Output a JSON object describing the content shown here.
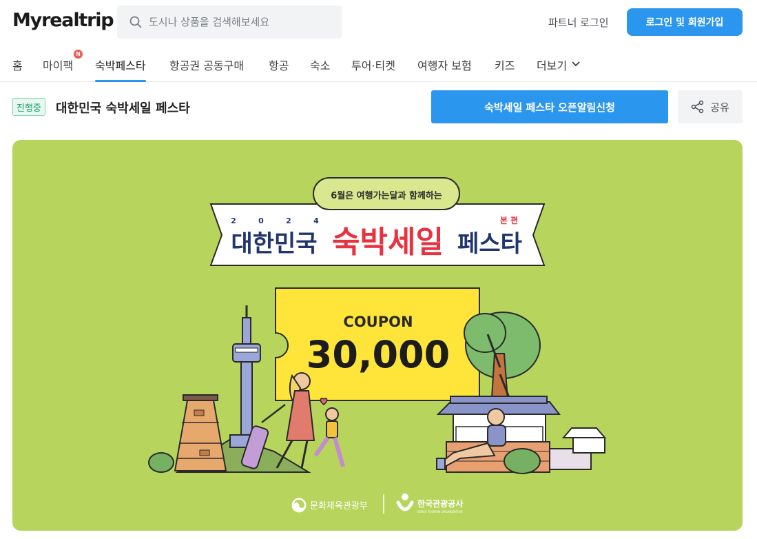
{
  "header": {
    "logo": "Myrealtrip",
    "search_placeholder": "도시나 상품을 검색해보세요",
    "partner_login": "파트너 로그인",
    "login_signup": "로그인 및 회원가입"
  },
  "nav": {
    "items": [
      "홈",
      "마이팩",
      "숙박페스타",
      "항공권 공동구매",
      "항공",
      "숙소",
      "투어·티켓",
      "여행자 보험",
      "키즈",
      "더보기"
    ],
    "badge": "N",
    "active": "숙박페스타"
  },
  "title_bar": {
    "status": "진행중",
    "title": "대한민국 숙박세일 페스타",
    "notify_button": "숙박세일 페스타 오픈알림신청",
    "share_button": "공유"
  },
  "banner": {
    "tagline": "6월은 여행가는달과 함께하는",
    "year_digits": [
      "2",
      "0",
      "2",
      "4"
    ],
    "headline_left": "대한민국",
    "headline_main": "숙박세일",
    "headline_right": "페스타",
    "edition": "본 편",
    "coupon_label": "COUPON",
    "coupon_value": "30,000",
    "sponsor_1": "문화체육관광부",
    "sponsor_2": "한국관광공사",
    "sponsor_2_sub": "KOREA TOURISM ORGANIZATION",
    "colors": {
      "background": "#b7d55c",
      "coupon": "#ffe53a",
      "headline_red": "#e7323f",
      "headline_navy": "#20356e"
    }
  }
}
